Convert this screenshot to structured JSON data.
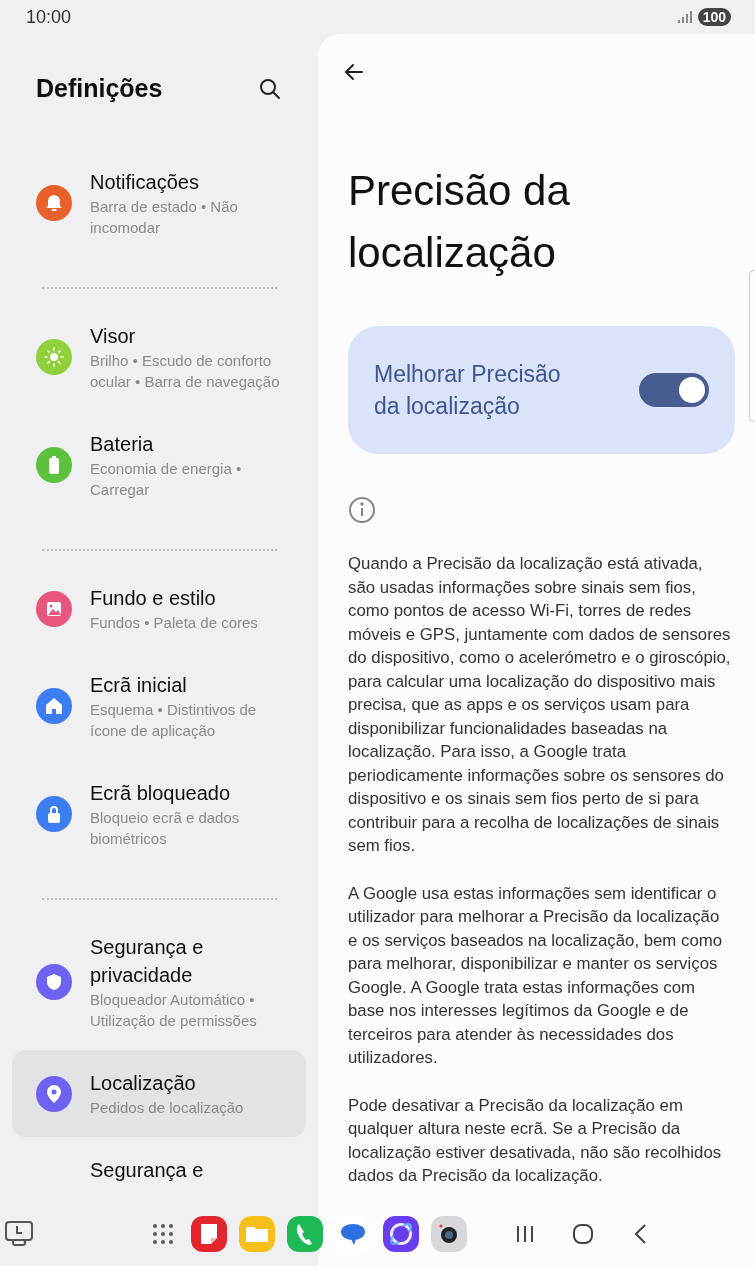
{
  "status_bar": {
    "time": "10:00",
    "battery": "100"
  },
  "sidebar": {
    "title": "Definições",
    "groups": [
      {
        "items": [
          {
            "kind": "bell",
            "color": "#e8602a",
            "title": "Notificações",
            "subtitle": "Barra de estado • Não incomodar",
            "selected": false
          }
        ]
      },
      {
        "items": [
          {
            "kind": "sun",
            "color": "#8fd13a",
            "title": "Visor",
            "subtitle": "Brilho • Escudo de conforto ocular • Barra de navegação",
            "selected": false
          },
          {
            "kind": "battery",
            "color": "#5cc23d",
            "title": "Bateria",
            "subtitle": "Economia de energia • Carregar",
            "selected": false
          }
        ]
      },
      {
        "items": [
          {
            "kind": "image",
            "color": "#e8557f",
            "title": "Fundo e estilo",
            "subtitle": "Fundos • Paleta de cores",
            "selected": false
          },
          {
            "kind": "home",
            "color": "#3d7df2",
            "title": "Ecrã inicial",
            "subtitle": "Esquema • Distintivos de ícone de aplicação",
            "selected": false
          },
          {
            "kind": "lock",
            "color": "#3d7df2",
            "title": "Ecrã bloqueado",
            "subtitle": "Bloqueio ecrã e dados biométricos",
            "selected": false
          }
        ]
      },
      {
        "items": [
          {
            "kind": "shield",
            "color": "#6e62f0",
            "title": "Segurança e privacidade",
            "subtitle": "Bloqueador Automático • Utilização de permissões",
            "selected": false
          },
          {
            "kind": "pin",
            "color": "#6e62f0",
            "title": "Localização",
            "subtitle": "Pedidos de localização",
            "selected": true
          },
          {
            "title": "Segurança e",
            "selected": false
          }
        ]
      }
    ]
  },
  "detail": {
    "title": "Precisão da localização",
    "toggle": {
      "label": "Melhorar Precisão da localização",
      "on": true
    },
    "paragraphs": [
      "Quando a Precisão da localização está ativada, são usadas informações sobre sinais sem fios, como pontos de acesso Wi-Fi, torres de redes móveis e GPS, juntamente com dados de sensores do dispositivo, como o acelerómetro e o giroscópio, para calcular uma localização do dispositivo mais precisa, que as apps e os serviços usam para disponibilizar funcionalidades baseadas na localização. Para isso, a Google trata periodicamente informações sobre os sensores do dispositivo e os sinais sem fios perto de si para contribuir para a recolha de localizações de sinais sem fios.",
      "A Google usa estas informações sem identificar o utilizador para melhorar a Precisão da localização e os serviços baseados na localização, bem como para melhorar, disponibilizar e manter os serviços Google. A Google trata estas informações com base nos interesses legítimos da Google e de terceiros para atender às necessidades dos utilizadores.",
      "Pode desativar a Precisão da localização em qualquer altura neste ecrã. Se a Precisão da localização estiver desativada, não são recolhidos dados da Precisão da localização."
    ]
  },
  "taskbar": {
    "apps": [
      {
        "kind": "notes"
      },
      {
        "kind": "folder"
      },
      {
        "kind": "phone"
      },
      {
        "kind": "messages"
      },
      {
        "kind": "browser"
      },
      {
        "kind": "camera"
      }
    ]
  }
}
